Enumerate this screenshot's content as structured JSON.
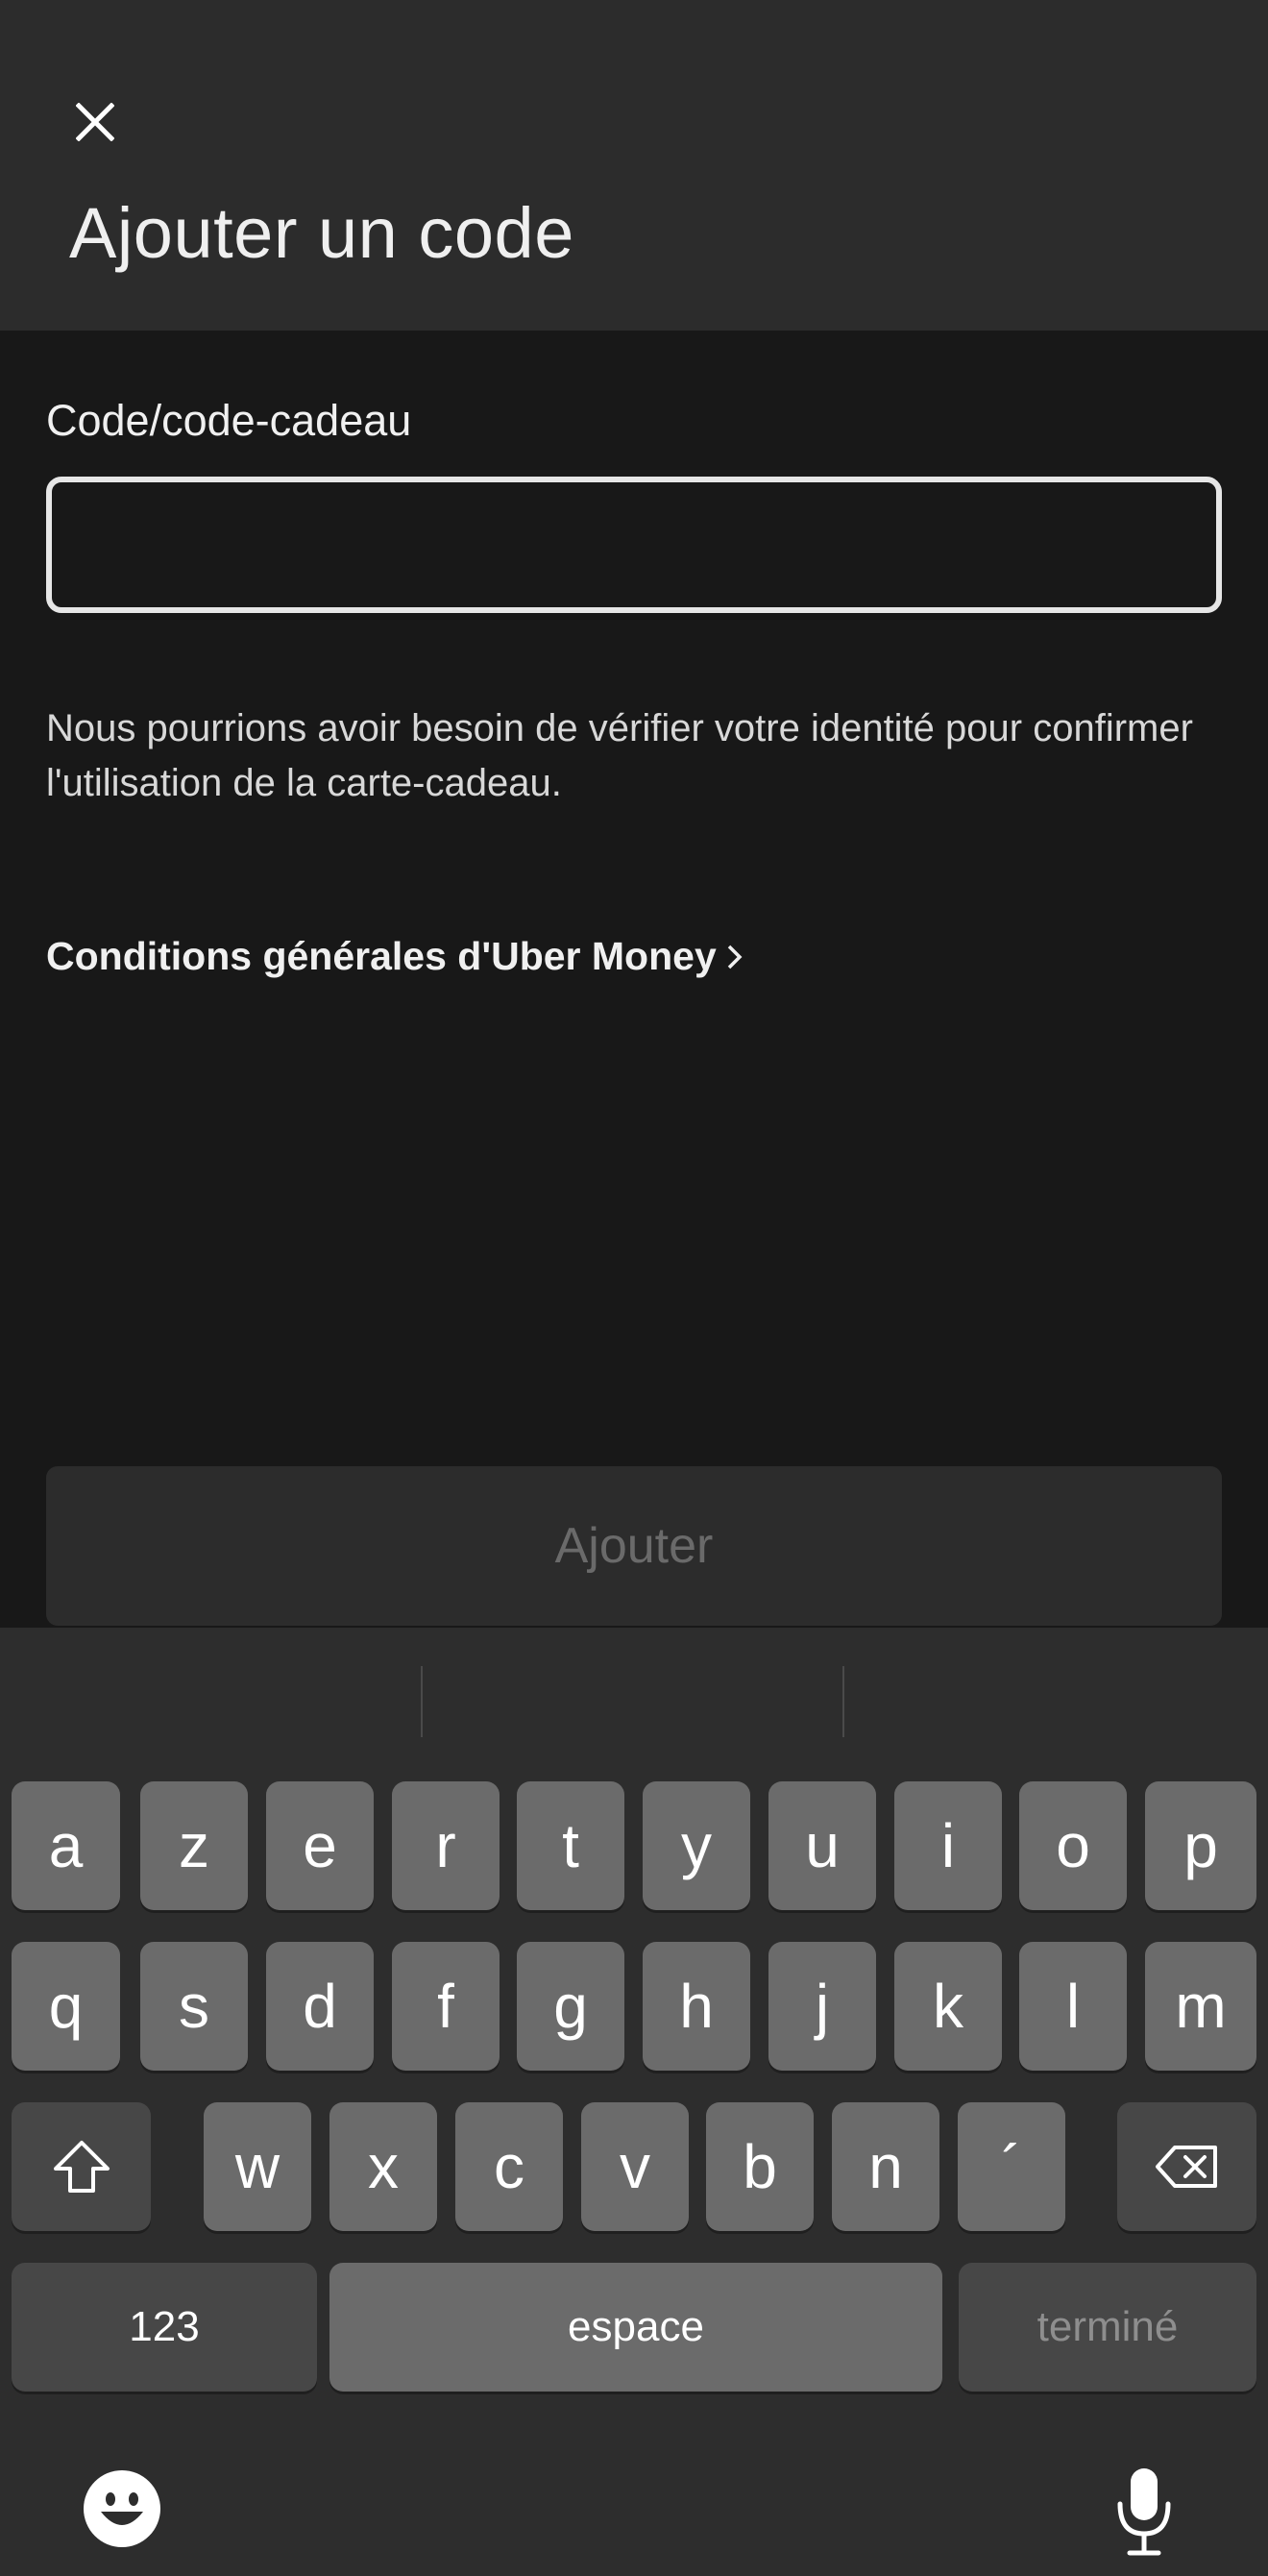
{
  "header": {
    "title": "Ajouter un code",
    "close_icon": "close-icon"
  },
  "form": {
    "field_label": "Code/code-cadeau",
    "input_value": "",
    "input_placeholder": "",
    "info_text": "Nous pourrions avoir besoin de vérifier votre identité pour confirmer l'utilisation de la carte-cadeau.",
    "terms_link": "Conditions générales d'Uber Money",
    "terms_icon": "chevron-right-icon",
    "submit_label": "Ajouter"
  },
  "keyboard": {
    "row1": [
      "a",
      "z",
      "e",
      "r",
      "t",
      "y",
      "u",
      "i",
      "o",
      "p"
    ],
    "row2": [
      "q",
      "s",
      "d",
      "f",
      "g",
      "h",
      "j",
      "k",
      "l",
      "m"
    ],
    "row3": [
      "w",
      "x",
      "c",
      "v",
      "b",
      "n",
      "´"
    ],
    "numbers_label": "123",
    "space_label": "espace",
    "done_label": "terminé",
    "shift_icon": "shift-icon",
    "delete_icon": "backspace-icon",
    "emoji_icon": "emoji-icon",
    "mic_icon": "microphone-icon"
  },
  "colors": {
    "header_bg": "#2c2c2c",
    "body_bg": "#181818",
    "keyboard_bg": "#2d2d2d",
    "key_bg": "#6b6b6b",
    "key_dark_bg": "#474747"
  }
}
